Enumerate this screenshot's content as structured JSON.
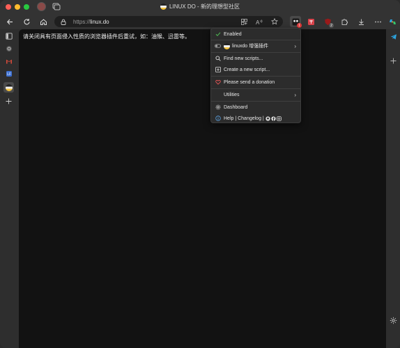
{
  "window": {
    "title": "LINUX DO - 新的理想型社区"
  },
  "toolbar": {
    "url_scheme": "https://",
    "url_host": "linux.do",
    "badge_count": "1",
    "badge2_count": "2"
  },
  "page": {
    "message": "请关闭具有页面侵入性质的浏览器插件后重试，如：油猴、迅雷等。"
  },
  "menu": {
    "enabled": "Enabled",
    "script_name": "linuxdo 增强插件",
    "find_scripts": "Find new scripts...",
    "create_script": "Create a new script...",
    "donation": "Please send a donation",
    "utilities": "Utilities",
    "dashboard": "Dashboard",
    "help": "Help | Changelog |"
  },
  "colors": {
    "accent_check": "#4caf50",
    "heart": "#e05555",
    "info": "#5aa0e0"
  }
}
